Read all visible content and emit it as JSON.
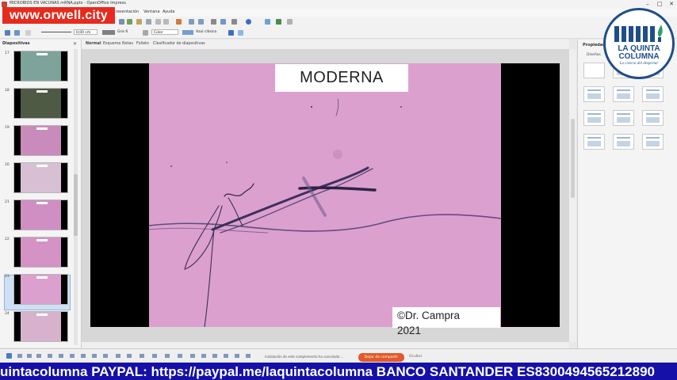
{
  "window": {
    "title": "MICROBIOS EN VACUNAS mRNA.pptx - OpenOffice Impress",
    "controls": [
      "–",
      "□",
      "✕"
    ]
  },
  "overlay": {
    "site_banner": "www.orwell.city"
  },
  "menubar": {
    "items": [
      "resentación",
      "Ventana",
      "Ayuda"
    ]
  },
  "toolbar2": {
    "line_width": "0,00 cm",
    "line_color": "Gris 6",
    "area_style": "Color",
    "area_color": "Azul clásico"
  },
  "slides_panel": {
    "title": "Diapositivas",
    "items": [
      {
        "num": "17",
        "color": "#7ea39a"
      },
      {
        "num": "18",
        "color": "#4f5a44"
      },
      {
        "num": "19",
        "color": "#c98bbb"
      },
      {
        "num": "20",
        "color": "#d8c0d4"
      },
      {
        "num": "21",
        "color": "#cf8fc3"
      },
      {
        "num": "22",
        "color": "#d592c4"
      },
      {
        "num": "23",
        "color": "#dca0ce"
      },
      {
        "num": "24",
        "color": "#d7b2cd"
      }
    ],
    "selected": "23"
  },
  "view_tabs": [
    "Normal",
    "Esquema",
    "Notas",
    "Folleto",
    "Clasificador de diapositivas"
  ],
  "slide": {
    "title": "MODERNA",
    "credit_line1": "©Dr. Campra",
    "credit_line2": "2021",
    "background": "#dca0ce"
  },
  "properties": {
    "title": "Propiedades",
    "section": "Diseños"
  },
  "logo": {
    "line1": "LA QUINTA",
    "line2": "COLUMNA",
    "tagline": "La ciencia del despertar"
  },
  "statusbar": {
    "notification": "instalación de este complemento ha cancelado ...",
    "button": "Dejar de compartir",
    "close": "Ocultar"
  },
  "ticker": {
    "text": "uintacolumna PAYPAL: https://paypal.me/laquintacolumna BANCO SANTANDER ES8300494565212890"
  },
  "colors": {
    "accent_red": "#e62b1e",
    "ticker_blue": "#1510a8",
    "logo_blue": "#1f4e87"
  }
}
